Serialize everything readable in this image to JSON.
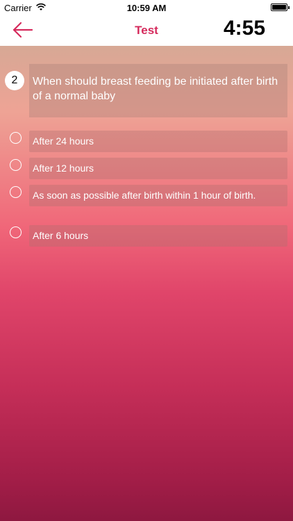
{
  "status_bar": {
    "carrier": "Carrier",
    "time": "10:59 AM",
    "battery_icon": "battery-full-icon",
    "wifi_icon": "wifi-icon"
  },
  "nav": {
    "back_icon": "arrow-left-icon",
    "title": "Test",
    "timer": "4:55"
  },
  "question": {
    "number": "2",
    "text": "When should breast feeding be initiated after birth of a normal baby"
  },
  "options": [
    {
      "label": "After 24 hours"
    },
    {
      "label": "After 12 hours"
    },
    {
      "label": "As soon as possible after birth within 1 hour of birth."
    },
    {
      "label": "After 6 hours"
    }
  ],
  "colors": {
    "accent": "#d52a5c"
  }
}
